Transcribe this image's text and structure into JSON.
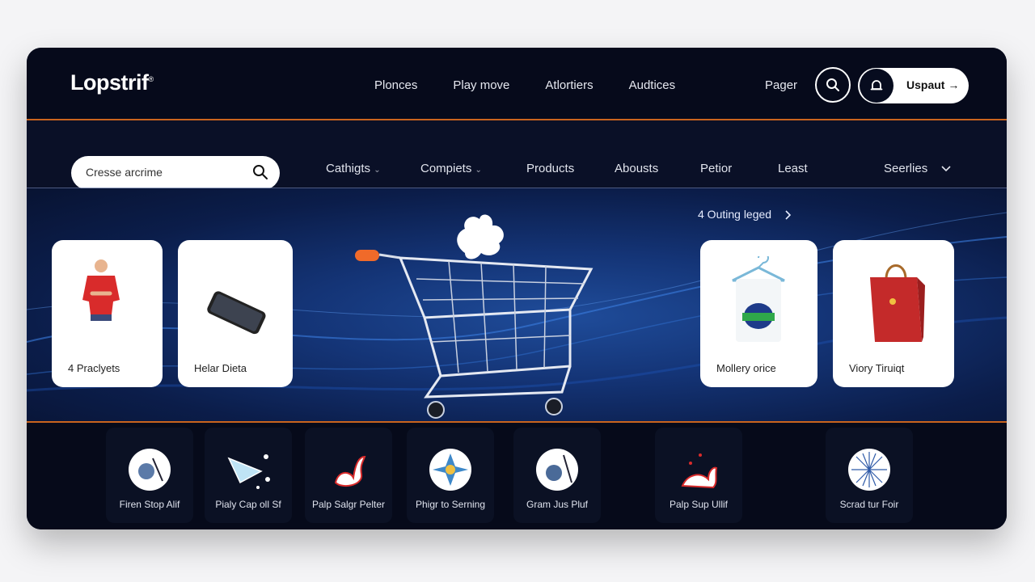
{
  "brand": {
    "logo": "Lopstrif",
    "logo_mark": "®"
  },
  "header": {
    "nav": [
      "Plonces",
      "Play move",
      "Atlortiers",
      "Audtices"
    ],
    "pages_label": "Pager",
    "upsell_label": "Uspaut →"
  },
  "subnav": {
    "search_placeholder": "Cresse arcrime",
    "categories": [
      "Cathigts",
      "Compiets",
      "Products",
      "Abousts",
      "Petior",
      "Least"
    ],
    "series_label": "Seerlies"
  },
  "hero": {
    "outing_label": "4 Outing leged",
    "cards_left": [
      "4 Praclyets",
      "Helar Dieta"
    ],
    "cards_right": [
      "Mollery orice",
      "Viory Tiruiqt"
    ]
  },
  "bottom_tiles": [
    "Firen Stop Alif",
    "Pialy Cap oll Sf",
    "Palp Salgr Pelter",
    "Phigr to Serning",
    "Gram Jus Pluf",
    "Palp Sup Ullif",
    "Scrad tur Foir"
  ],
  "colors": {
    "accent": "#c9641e",
    "bg_dark": "#070c1f",
    "hero_blue": "#1f4c9a",
    "cart_handle": "#f06a2a"
  },
  "icons": [
    "search-icon",
    "bell-icon",
    "chevron-down-icon",
    "chevron-right-icon",
    "shopping-cart-icon",
    "hand-logo-icon"
  ]
}
